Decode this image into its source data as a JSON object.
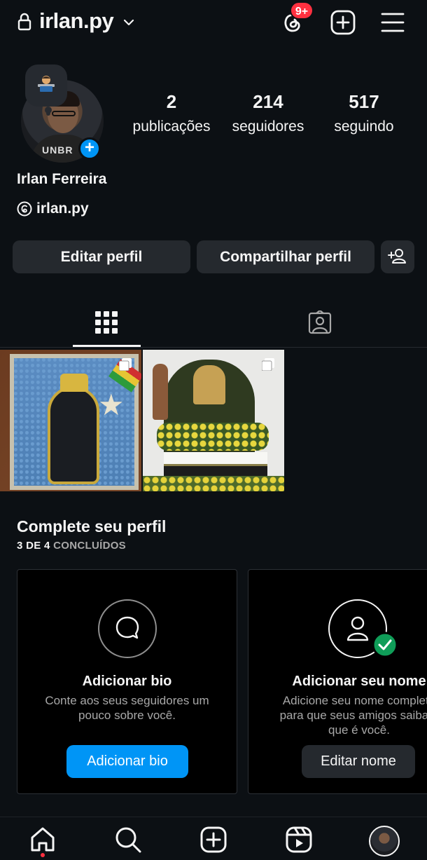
{
  "header": {
    "username": "irlan.py",
    "notification_badge": "9+",
    "lock_icon": "lock-icon",
    "chevron_icon": "chevron-down-icon",
    "threads_icon": "threads-icon",
    "create_icon": "plus-square-icon",
    "menu_icon": "hamburger-menu-icon"
  },
  "profile": {
    "full_name": "Irlan Ferreira",
    "threads_handle": "irlan.py",
    "note_emoji": "👨‍💻",
    "stats": [
      {
        "value": "2",
        "label": "publicações"
      },
      {
        "value": "214",
        "label": "seguidores"
      },
      {
        "value": "517",
        "label": "seguindo"
      }
    ]
  },
  "actions": {
    "edit_profile": "Editar perfil",
    "share_profile": "Compartilhar perfil",
    "discover_people_icon": "add-person-icon"
  },
  "tabs": [
    {
      "name": "posts-grid",
      "icon": "grid-icon",
      "active": true
    },
    {
      "name": "tagged",
      "icon": "tagged-person-icon",
      "active": false
    }
  ],
  "posts": [
    {
      "description": "mosaic-artwork",
      "multiple": true
    },
    {
      "description": "altar-photo",
      "multiple": true
    }
  ],
  "complete_profile": {
    "title": "Complete seu perfil",
    "progress_count": "3 DE 4",
    "progress_done": "CONCLUÍDOS",
    "cards": [
      {
        "title": "Adicionar bio",
        "description": "Conte aos seus seguidores um pouco sobre você.",
        "button": "Adicionar bio",
        "icon": "chat-bubble-icon"
      },
      {
        "title": "Adicionar seu nome",
        "description": "Adicione seu nome completo para que seus amigos saibam que é você.",
        "button": "Editar nome",
        "icon": "user-check-icon"
      }
    ]
  },
  "colors": {
    "background": "#0c1014",
    "button_bg": "#25292e",
    "accent_blue": "#0095f6",
    "badge_red": "#ff3040",
    "success_green": "#0f9d58"
  },
  "bottom_nav": [
    "home-icon",
    "search-icon",
    "create-icon",
    "reels-icon",
    "profile-avatar"
  ]
}
